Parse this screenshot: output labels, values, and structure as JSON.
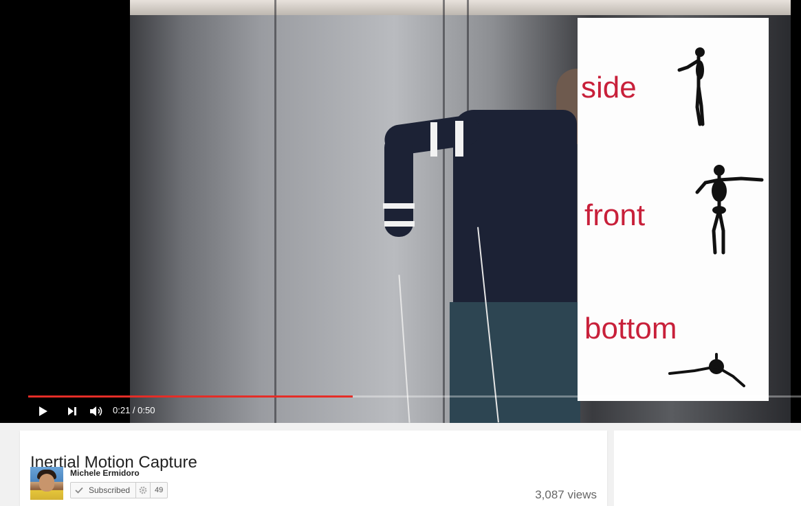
{
  "video": {
    "overlay_labels": {
      "side": "side",
      "front": "front",
      "bottom": "bottom"
    },
    "progress": {
      "played_fraction": 0.42
    },
    "controls": {
      "play_icon": "play-icon",
      "next_icon": "next-icon",
      "volume_icon": "volume-icon",
      "time_current": "0:21",
      "time_separator": " / ",
      "time_total": "0:50",
      "time_display": "0:21 / 0:50"
    }
  },
  "info": {
    "title": "Inertial Motion Capture",
    "channel": {
      "name": "Michele Ermidoro",
      "subscribe_label": "Subscribed",
      "subscriber_count": "49"
    },
    "views": "3,087 views"
  },
  "colors": {
    "progress_red": "#e52d27",
    "overlay_text_red": "#c8203a"
  }
}
